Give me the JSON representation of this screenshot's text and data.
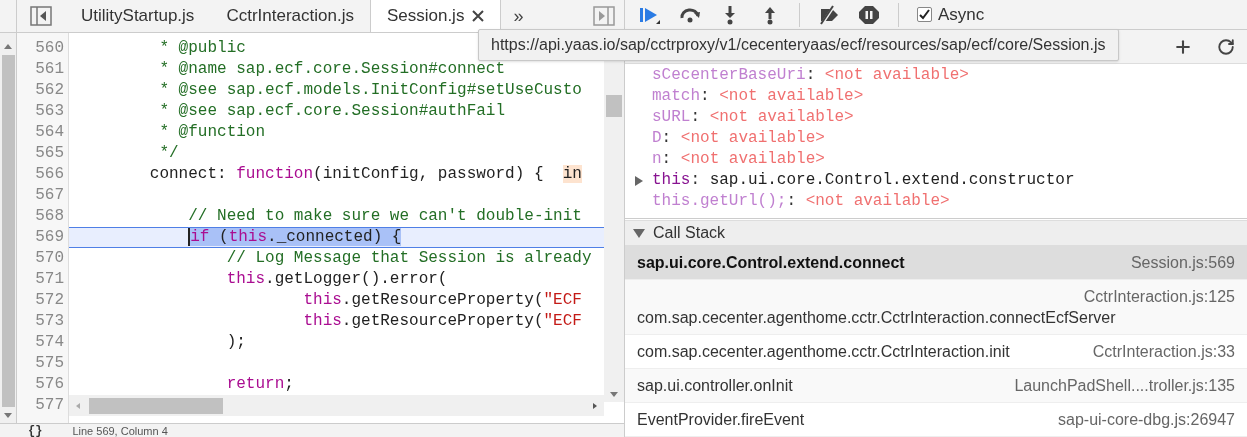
{
  "editor_tabs": [
    {
      "label": "UtilityStartup.js",
      "selected": false
    },
    {
      "label": "CctrInteraction.js",
      "selected": false
    },
    {
      "label": "Session.js",
      "selected": true
    }
  ],
  "more_tabs": "»",
  "tooltip": "https://api.yaas.io/sap/cctrproxy/v1/cecenteryaas/ecf/resources/sap/ecf/core/Session.js",
  "code": {
    "gutter": [
      "560",
      "561",
      "562",
      "563",
      "564",
      "565",
      "566",
      "567",
      "568",
      "569",
      "570",
      "571",
      "572",
      "573",
      "574",
      "575",
      "576",
      "577"
    ],
    "lines": [
      {
        "current": false,
        "tokens": [
          {
            "text": "         * @public",
            "kind": "comment"
          }
        ]
      },
      {
        "current": false,
        "tokens": [
          {
            "text": "         * @name sap.ecf.core.Session#connect",
            "kind": "comment"
          }
        ]
      },
      {
        "current": false,
        "tokens": [
          {
            "text": "         * @see sap.ecf.models.InitConfig#setUseCusto",
            "kind": "comment"
          }
        ]
      },
      {
        "current": false,
        "tokens": [
          {
            "text": "         * @see sap.ecf.core.Session#authFail",
            "kind": "comment"
          }
        ]
      },
      {
        "current": false,
        "tokens": [
          {
            "text": "         * @function",
            "kind": "comment"
          }
        ]
      },
      {
        "current": false,
        "tokens": [
          {
            "text": "         */",
            "kind": "comment"
          }
        ]
      },
      {
        "current": false,
        "tokens": [
          {
            "text": "        connect: ",
            "kind": "plain"
          },
          {
            "text": "function",
            "kind": "keyword"
          },
          {
            "text": "(initConfig, password) {  ",
            "kind": "plain"
          },
          {
            "text": "in",
            "kind": "hint"
          }
        ]
      },
      {
        "current": false
      },
      {
        "current": false,
        "tokens": [
          {
            "text": "            // Need to make sure we can't double-init",
            "kind": "comment"
          }
        ]
      },
      {
        "current": true,
        "tokens": [
          {
            "text": "            if",
            "kind": "keyword"
          },
          {
            "text": " (",
            "kind": "plain"
          },
          {
            "text": "this",
            "kind": "keyword"
          },
          {
            "text": "._connected) {",
            "kind": "plain"
          }
        ]
      },
      {
        "current": false,
        "tokens": [
          {
            "text": "                // Log Message that Session is already",
            "kind": "comment"
          }
        ]
      },
      {
        "current": false,
        "tokens": [
          {
            "text": "                this",
            "kind": "keyword"
          },
          {
            "text": ".getLogger().error(",
            "kind": "plain"
          }
        ]
      },
      {
        "current": false,
        "tokens": [
          {
            "text": "                        this",
            "kind": "keyword"
          },
          {
            "text": ".getResourceProperty(",
            "kind": "plain"
          },
          {
            "text": "\"ECF",
            "kind": "string"
          }
        ]
      },
      {
        "current": false,
        "tokens": [
          {
            "text": "                        this",
            "kind": "keyword"
          },
          {
            "text": ".getResourceProperty(",
            "kind": "plain"
          },
          {
            "text": "\"ECF",
            "kind": "string"
          }
        ]
      },
      {
        "current": false,
        "tokens": [
          {
            "text": "                );",
            "kind": "plain"
          }
        ]
      },
      {
        "current": false
      },
      {
        "current": false,
        "tokens": [
          {
            "text": "                return",
            "kind": "keyword"
          },
          {
            "text": ";",
            "kind": "plain"
          }
        ]
      }
    ],
    "format_button": "{}",
    "status": "Line 569, Column 4"
  },
  "async": {
    "label": "Async",
    "checked": true
  },
  "scope": [
    {
      "name": "sCecenterBaseUri",
      "separator": ":",
      "value": "<not available>",
      "kind": "unavailable"
    },
    {
      "name": "match",
      "separator": ":",
      "value": "<not available>",
      "kind": "unavailable"
    },
    {
      "name": "sURL",
      "separator": ":",
      "value": "<not available>",
      "kind": "unavailable"
    },
    {
      "name": "D",
      "separator": ":",
      "value": "<not available>",
      "kind": "unavailable"
    },
    {
      "name": "n",
      "separator": ":",
      "value": "<not available>",
      "kind": "unavailable"
    },
    {
      "name": "this",
      "separator": ":",
      "value": "sap.ui.core.Control.extend.constructor",
      "kind": "object",
      "expanded": false
    },
    {
      "name": "this.getUrl();",
      "separator": ":",
      "value": "<not available>",
      "kind": "unavailable"
    }
  ],
  "call_stack": {
    "title": "Call Stack",
    "expanded": true,
    "frames": [
      {
        "function": "sap.ui.core.Control.extend.connect",
        "location": "Session.js:569",
        "selected": true,
        "kind": "inline"
      },
      {
        "function": "com.sap.cecenter.agenthome.cctr.CctrInteraction.connectEcfServer",
        "location": "CctrInteraction.js:125",
        "selected": false,
        "kind": "wrapped"
      },
      {
        "function": "com.sap.cecenter.agenthome.cctr.CctrInteraction.init",
        "location": "CctrInteraction.js:33",
        "selected": false,
        "kind": "inline"
      },
      {
        "function": "sap.ui.controller.onInit",
        "location": "LaunchPadShell....troller.js:135",
        "selected": false,
        "kind": "inline"
      },
      {
        "function": "EventProvider.fireEvent",
        "location": "sap-ui-core-dbg.js:26947",
        "selected": false,
        "kind": "inline"
      }
    ]
  }
}
